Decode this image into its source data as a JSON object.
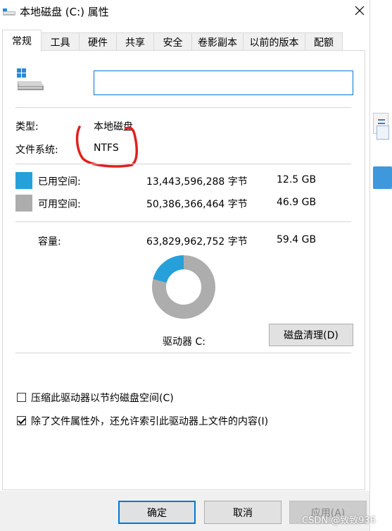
{
  "window": {
    "title": "本地磁盘 (C:) 属性"
  },
  "tabs": [
    "常规",
    "工具",
    "硬件",
    "共享",
    "安全",
    "卷影副本",
    "以前的版本",
    "配额"
  ],
  "general": {
    "name_value": "",
    "type_label": "类型:",
    "type_value": "本地磁盘",
    "fs_label": "文件系统:",
    "fs_value": "NTFS",
    "used_label": "已用空间:",
    "used_bytes": "13,443,596,288 字节",
    "used_gb": "12.5 GB",
    "free_label": "可用空间:",
    "free_bytes": "50,386,366,464 字节",
    "free_gb": "46.9 GB",
    "capacity_label": "容量:",
    "capacity_bytes": "63,829,962,752 字节",
    "capacity_gb": "59.4 GB",
    "drive_label": "驱动器 C:",
    "cleanup_label": "磁盘清理(D)",
    "compress_label": "压缩此驱动器以节约磁盘空间(C)",
    "compress_checked": false,
    "index_label": "除了文件属性外，还允许索引此驱动器上文件的内容(I)",
    "index_checked": true
  },
  "usage": {
    "used_fraction": 0.21,
    "used_color": "#26a0da",
    "free_color": "#adadad"
  },
  "buttons": {
    "ok": "确定",
    "cancel": "取消",
    "apply": "应用(A)"
  },
  "watermark": "CSDN @致致936"
}
